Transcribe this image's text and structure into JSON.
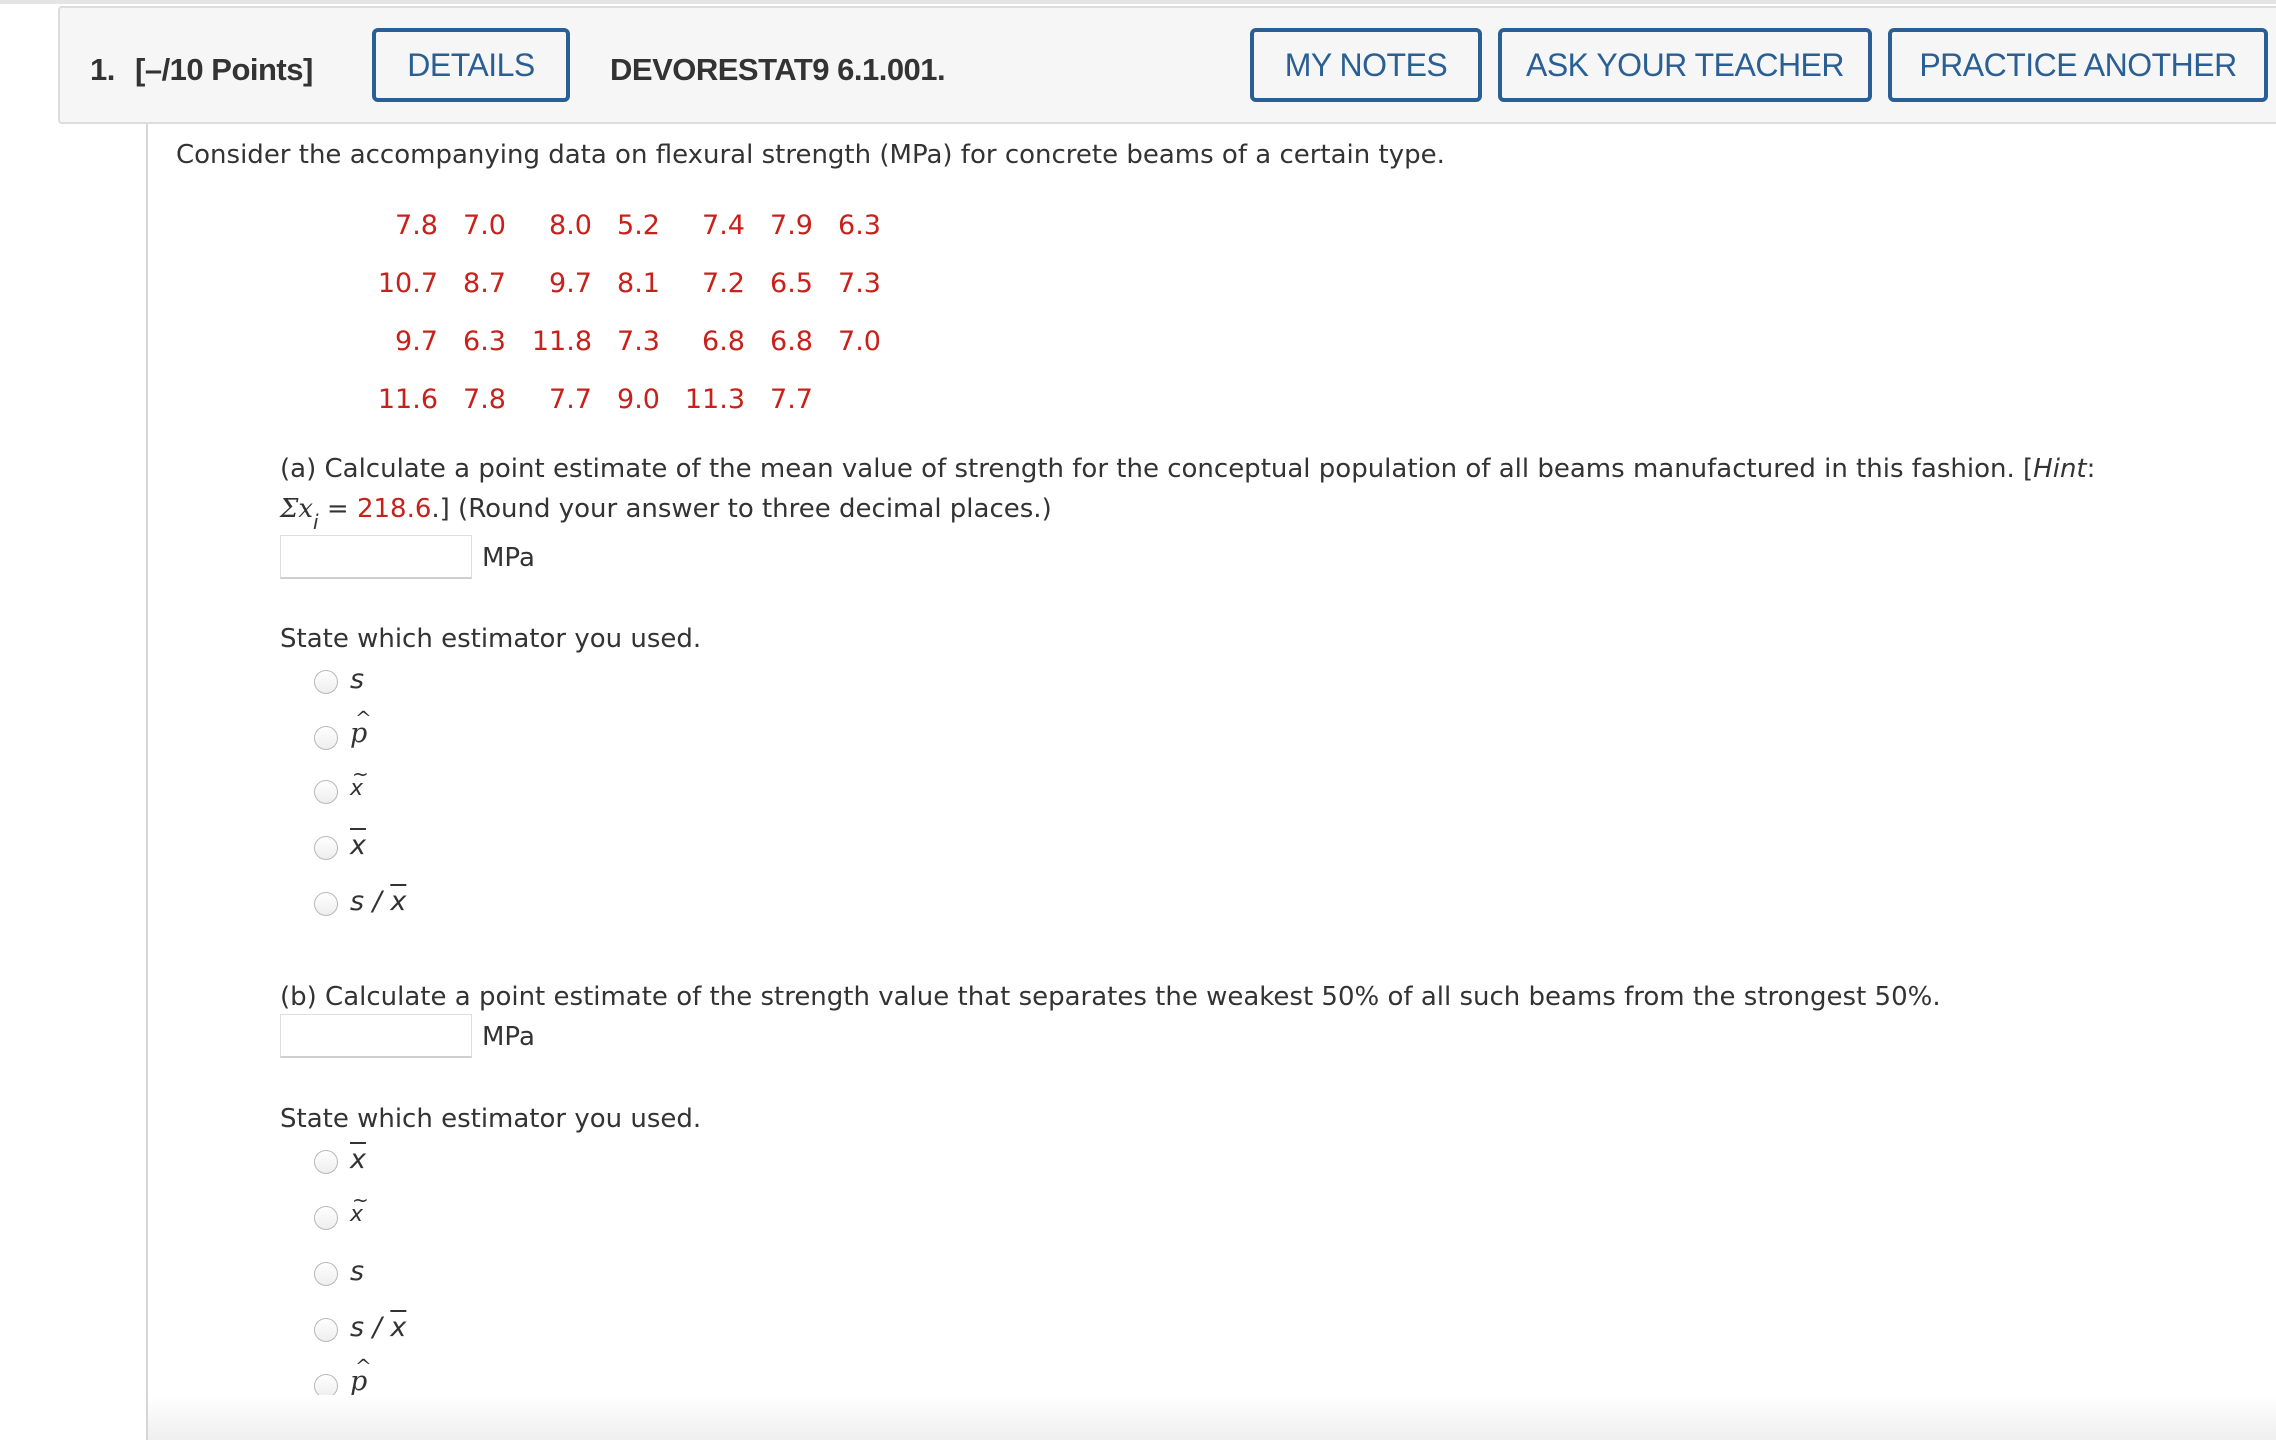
{
  "header": {
    "question_number": "1.",
    "points": "[–/10 Points]",
    "details_label": "DETAILS",
    "question_id": "DEVORESTAT9 6.1.001.",
    "my_notes_label": "MY NOTES",
    "ask_teacher_label": "ASK YOUR TEACHER",
    "practice_another_label": "PRACTICE ANOTHER"
  },
  "colors": {
    "accent": "#2a5f95",
    "data_red": "#c8201a",
    "text": "#333333"
  },
  "intro": "Consider the accompanying data on flexural strength (MPa) for concrete beams of a certain type.",
  "data_rows": [
    [
      "7.8",
      "7.0",
      "8.0",
      "5.2",
      "7.4",
      "7.9",
      "6.3"
    ],
    [
      "10.7",
      "8.7",
      "9.7",
      "8.1",
      "7.2",
      "6.5",
      "7.3"
    ],
    [
      "9.7",
      "6.3",
      "11.8",
      "7.3",
      "6.8",
      "6.8",
      "7.0"
    ],
    [
      "11.6",
      "7.8",
      "7.7",
      "9.0",
      "11.3",
      "7.7",
      ""
    ]
  ],
  "part_a": {
    "prompt_line1_start": "(a) Calculate a point estimate of the mean value of strength for the conceptual population of all beams manufactured in this fashion. [",
    "hint_word": "Hint",
    "prompt_line1_end": ":",
    "sigma": "Σx",
    "subscript": "i",
    "equals": " = ",
    "hint_value": "218.6",
    "prompt_line2_end": ".] (Round your answer to three decimal places.)",
    "answer_value": "",
    "unit": "MPa",
    "estimator_prompt": "State which estimator you used.",
    "options": [
      "s",
      "p̂",
      "x̃",
      "x̄",
      "s / x̄"
    ]
  },
  "part_b": {
    "prompt": "(b) Calculate a point estimate of the strength value that separates the weakest 50% of all such beams from the strongest 50%.",
    "answer_value": "",
    "unit": "MPa",
    "estimator_prompt": "State which estimator you used.",
    "options": [
      "x̄",
      "x̃",
      "s",
      "s / x̄",
      "p̂"
    ]
  }
}
